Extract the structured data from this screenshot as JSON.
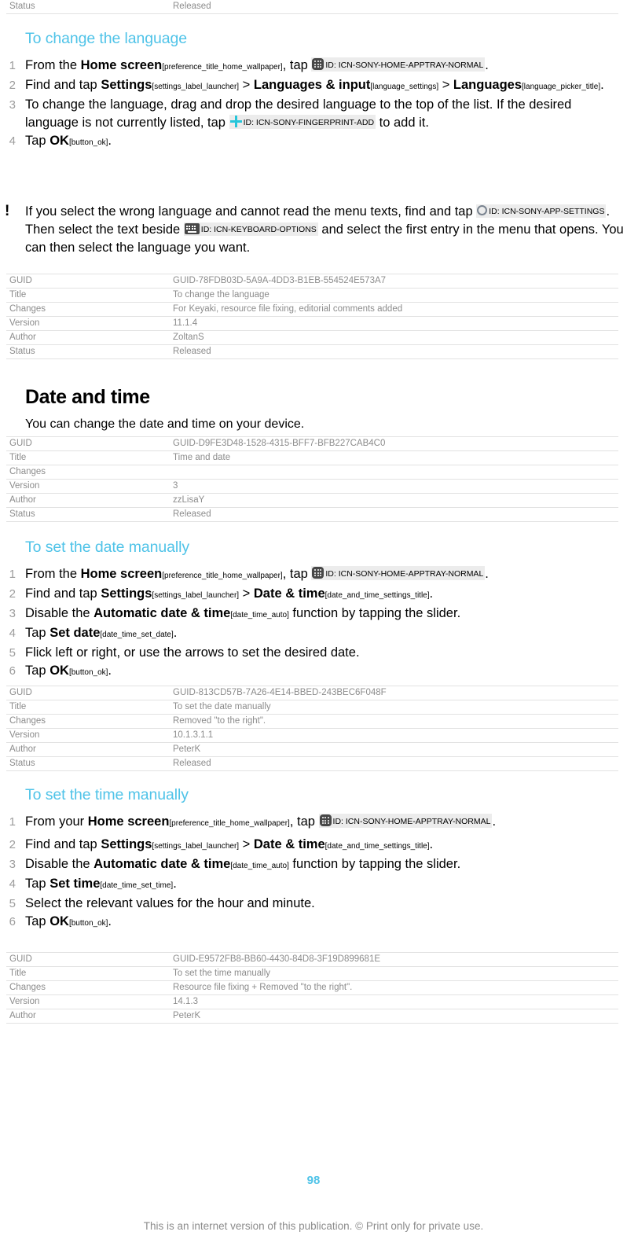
{
  "page": {
    "number": "98",
    "footer": "This is an internet version of this publication. © Print only for private use."
  },
  "top_table_partial": {
    "rows": [
      {
        "key": "Status",
        "value": "Released"
      }
    ]
  },
  "sections": [
    {
      "id": "to-change-the-language",
      "heading": "To change the language",
      "steps": [
        {
          "num": "1",
          "parts": [
            {
              "t": "text",
              "v": "From the "
            },
            {
              "t": "ui",
              "v": "Home screen"
            },
            {
              "t": "res",
              "v": "[preference_title_home_wallpaper]"
            },
            {
              "t": "text",
              "v": ", tap "
            },
            {
              "t": "chip",
              "icon": "apptray-icon",
              "v": "ID: ICN-SONY-HOME-APPTRAY-NORMAL"
            },
            {
              "t": "text",
              "v": "."
            }
          ]
        },
        {
          "num": "2",
          "parts": [
            {
              "t": "text",
              "v": "Find and tap "
            },
            {
              "t": "ui",
              "v": "Settings"
            },
            {
              "t": "res",
              "v": "[settings_label_launcher]"
            },
            {
              "t": "text",
              "v": " > "
            },
            {
              "t": "ui",
              "v": "Languages & input"
            },
            {
              "t": "res",
              "v": "[language_settings]"
            },
            {
              "t": "text",
              "v": " > "
            },
            {
              "t": "ui",
              "v": "Languages"
            },
            {
              "t": "res",
              "v": "[language_picker_title]"
            },
            {
              "t": "text",
              "v": "."
            }
          ]
        },
        {
          "num": "3",
          "parts": [
            {
              "t": "text",
              "v": "To change the language, drag and drop the desired language to the top of the list. If the desired language is not currently listed, tap "
            },
            {
              "t": "chip",
              "icon": "plus-icon",
              "v": "ID: ICN-SONY-FINGERPRINT-ADD"
            },
            {
              "t": "text",
              "v": " to add it."
            }
          ]
        },
        {
          "num": "4",
          "parts": [
            {
              "t": "text",
              "v": "Tap "
            },
            {
              "t": "ui",
              "v": "OK"
            },
            {
              "t": "res",
              "v": "[button_ok]"
            },
            {
              "t": "text",
              "v": "."
            }
          ]
        }
      ],
      "note": {
        "icon": "exclamation-icon",
        "parts": [
          {
            "t": "text",
            "v": "If you select the wrong language and cannot read the menu texts, find and tap "
          },
          {
            "t": "chip",
            "icon": "circle-icon",
            "v": "ID: ICN-SONY-APP-SETTINGS"
          },
          {
            "t": "text",
            "v": ". Then select the text beside "
          },
          {
            "t": "chip",
            "icon": "keyboard-icon",
            "v": "ID: ICN-KEYBOARD-OPTIONS"
          },
          {
            "t": "text",
            "v": " and select the first entry in the menu that opens. You can then select the language you want."
          }
        ]
      },
      "table": {
        "rows": [
          {
            "key": "GUID",
            "value": "GUID-78FDB03D-5A9A-4DD3-B1EB-554524E573A7"
          },
          {
            "key": "Title",
            "value": "To change the language"
          },
          {
            "key": "Changes",
            "value": "For Keyaki, resource file fixing, editorial comments added"
          },
          {
            "key": "Version",
            "value": "11.1.4"
          },
          {
            "key": "Author",
            "value": "ZoltanS"
          },
          {
            "key": "Status",
            "value": "Released"
          }
        ]
      }
    },
    {
      "id": "date-and-time",
      "chapter_heading": "Date and time",
      "intro": "You can change the date and time on your device.",
      "table": {
        "rows": [
          {
            "key": "GUID",
            "value": "GUID-D9FE3D48-1528-4315-BFF7-BFB227CAB4C0"
          },
          {
            "key": "Title",
            "value": "Time and date"
          },
          {
            "key": "Changes",
            "value": ""
          },
          {
            "key": "Version",
            "value": "3"
          },
          {
            "key": "Author",
            "value": "zzLisaY"
          },
          {
            "key": "Status",
            "value": "Released"
          }
        ]
      }
    },
    {
      "id": "to-set-the-date-manually",
      "heading": "To set the date manually",
      "steps": [
        {
          "num": "1",
          "parts": [
            {
              "t": "text",
              "v": "From the "
            },
            {
              "t": "ui",
              "v": "Home screen"
            },
            {
              "t": "res",
              "v": "[preference_title_home_wallpaper]"
            },
            {
              "t": "text",
              "v": ", tap "
            },
            {
              "t": "chip",
              "icon": "apptray-icon",
              "v": "ID: ICN-SONY-HOME-APPTRAY-NORMAL"
            },
            {
              "t": "text",
              "v": "."
            }
          ]
        },
        {
          "num": "2",
          "parts": [
            {
              "t": "text",
              "v": "Find and tap "
            },
            {
              "t": "ui",
              "v": "Settings"
            },
            {
              "t": "res",
              "v": "[settings_label_launcher]"
            },
            {
              "t": "text",
              "v": " > "
            },
            {
              "t": "ui",
              "v": "Date & time"
            },
            {
              "t": "res",
              "v": "[date_and_time_settings_title]"
            },
            {
              "t": "text",
              "v": "."
            }
          ]
        },
        {
          "num": "3",
          "parts": [
            {
              "t": "text",
              "v": "Disable the "
            },
            {
              "t": "ui",
              "v": "Automatic date & time"
            },
            {
              "t": "res",
              "v": "[date_time_auto]"
            },
            {
              "t": "text",
              "v": " function by tapping the slider."
            }
          ]
        },
        {
          "num": "4",
          "parts": [
            {
              "t": "text",
              "v": "Tap "
            },
            {
              "t": "ui",
              "v": "Set date"
            },
            {
              "t": "res",
              "v": "[date_time_set_date]"
            },
            {
              "t": "text",
              "v": "."
            }
          ]
        },
        {
          "num": "5",
          "parts": [
            {
              "t": "text",
              "v": "Flick left or right, or use the arrows to set the desired date."
            }
          ]
        },
        {
          "num": "6",
          "parts": [
            {
              "t": "text",
              "v": "Tap "
            },
            {
              "t": "ui",
              "v": "OK"
            },
            {
              "t": "res",
              "v": "[button_ok]"
            },
            {
              "t": "text",
              "v": "."
            }
          ]
        }
      ],
      "table": {
        "rows": [
          {
            "key": "GUID",
            "value": "GUID-813CD57B-7A26-4E14-BBED-243BEC6F048F"
          },
          {
            "key": "Title",
            "value": "To set the date manually"
          },
          {
            "key": "Changes",
            "value": "Removed \"to the right\"."
          },
          {
            "key": "Version",
            "value": "10.1.3.1.1"
          },
          {
            "key": "Author",
            "value": "PeterK"
          },
          {
            "key": "Status",
            "value": "Released"
          }
        ]
      }
    },
    {
      "id": "to-set-the-time-manually",
      "heading": "To set the time manually",
      "steps": [
        {
          "num": "1",
          "parts": [
            {
              "t": "text",
              "v": "From your "
            },
            {
              "t": "ui",
              "v": "Home screen"
            },
            {
              "t": "res",
              "v": "[preference_title_home_wallpaper]"
            },
            {
              "t": "text",
              "v": ", tap "
            },
            {
              "t": "chip",
              "icon": "apptray-icon",
              "v": "ID: ICN-SONY-HOME-APPTRAY-NORMAL"
            },
            {
              "t": "text",
              "v": "."
            }
          ]
        },
        {
          "num": "2",
          "parts": [
            {
              "t": "text",
              "v": "Find and tap "
            },
            {
              "t": "ui",
              "v": "Settings"
            },
            {
              "t": "res",
              "v": "[settings_label_launcher]"
            },
            {
              "t": "text",
              "v": " > "
            },
            {
              "t": "ui",
              "v": "Date & time"
            },
            {
              "t": "res",
              "v": "[date_and_time_settings_title]"
            },
            {
              "t": "text",
              "v": "."
            }
          ]
        },
        {
          "num": "3",
          "parts": [
            {
              "t": "text",
              "v": "Disable the "
            },
            {
              "t": "ui",
              "v": "Automatic date & time"
            },
            {
              "t": "res",
              "v": "[date_time_auto]"
            },
            {
              "t": "text",
              "v": " function by tapping the slider."
            }
          ]
        },
        {
          "num": "4",
          "parts": [
            {
              "t": "text",
              "v": "Tap "
            },
            {
              "t": "ui",
              "v": "Set time"
            },
            {
              "t": "res",
              "v": "[date_time_set_time]"
            },
            {
              "t": "text",
              "v": "."
            }
          ]
        },
        {
          "num": "5",
          "parts": [
            {
              "t": "text",
              "v": "Select the relevant values for the hour and minute."
            }
          ]
        },
        {
          "num": "6",
          "parts": [
            {
              "t": "text",
              "v": "Tap "
            },
            {
              "t": "ui",
              "v": "OK"
            },
            {
              "t": "res",
              "v": "[button_ok]"
            },
            {
              "t": "text",
              "v": "."
            }
          ]
        }
      ],
      "table": {
        "rows": [
          {
            "key": "GUID",
            "value": "GUID-E9572FB8-BB60-4430-84D8-3F19D899681E"
          },
          {
            "key": "Title",
            "value": "To set the time manually"
          },
          {
            "key": "Changes",
            "value": "Resource file fixing + Removed \"to the right\"."
          },
          {
            "key": "Version",
            "value": "14.1.3"
          },
          {
            "key": "Author",
            "value": "PeterK"
          }
        ]
      }
    }
  ],
  "colors": {
    "heading_blue": "#4fc3e8",
    "table_text": "#8c8c8c",
    "step_number": "#9c9c9c",
    "chip_bg": "#ececec",
    "plus_icon": "#26c6da"
  }
}
